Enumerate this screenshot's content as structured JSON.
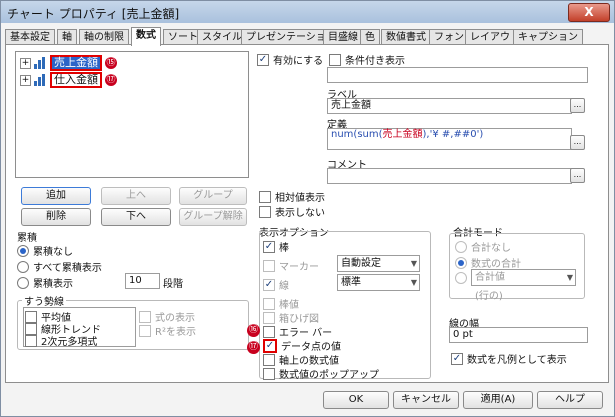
{
  "window": {
    "title": "チャート プロパティ [売上金額]",
    "close": "X"
  },
  "tabs": [
    "基本設定",
    "軸",
    "軸の制限",
    "数式",
    "ソート",
    "スタイル",
    "プレゼンテーション",
    "目盛線",
    "色",
    "数値書式",
    "フォント",
    "レイアウト",
    "キャプション"
  ],
  "expressions": {
    "items": [
      {
        "label": "売上金額",
        "marker": "⑮"
      },
      {
        "label": "仕入金額",
        "marker": "⑰"
      }
    ],
    "plus": "+",
    "buttons": {
      "add": "追加",
      "up": "上へ",
      "group": "グループ",
      "delete": "削除",
      "down": "下へ",
      "ungroup": "グループ解除"
    }
  },
  "accumulation": {
    "legend": "累積",
    "none": "累積なし",
    "all": "すべて累積表示",
    "show": "累積表示",
    "steps_value": "10",
    "steps_label": "段階"
  },
  "trendline": {
    "legend": "すう勢線",
    "items": [
      "平均値",
      "線形トレンド",
      "2次元多項式"
    ],
    "show_formula": "式の表示",
    "show_r2": "R²を表示"
  },
  "enable": {
    "label": "有効にする",
    "checked": "✓"
  },
  "conditional": {
    "label": "条件付き表示"
  },
  "label_field": {
    "label": "ラベル",
    "value": "売上金額",
    "btn": "..."
  },
  "definition": {
    "label": "定義",
    "pre": "num(sum(",
    "field": "売上金額",
    "post": "),'¥ #,##0')",
    "btn": "..."
  },
  "comment": {
    "label": "コメント",
    "btn": "..."
  },
  "relative": {
    "label": "相対値表示"
  },
  "invisible": {
    "label": "表示しない"
  },
  "display_options": {
    "legend": "表示オプション",
    "bar": "棒",
    "marker": "マーカー",
    "marker_style": "自動設定",
    "line": "線",
    "line_style": "標準",
    "stick": "棒値",
    "box": "箱ひげ図",
    "error_bar": "エラー バー",
    "data_values": "データ点の値",
    "axis_values": "軸上の数式値",
    "popup": "数式値のポップアップ",
    "marker_16": "⑯",
    "marker_17": "⑰"
  },
  "total_mode": {
    "legend": "合計モード",
    "none": "合計なし",
    "sum": "数式の合計",
    "combo_value": "合計値",
    "rows": "(行の)"
  },
  "width": {
    "label": "線の幅",
    "value": "0 pt"
  },
  "legend_expr": {
    "label": "数式を凡例として表示"
  },
  "footer": {
    "ok": "OK",
    "cancel": "キャンセル",
    "apply": "適用(A)",
    "help": "ヘルプ"
  }
}
